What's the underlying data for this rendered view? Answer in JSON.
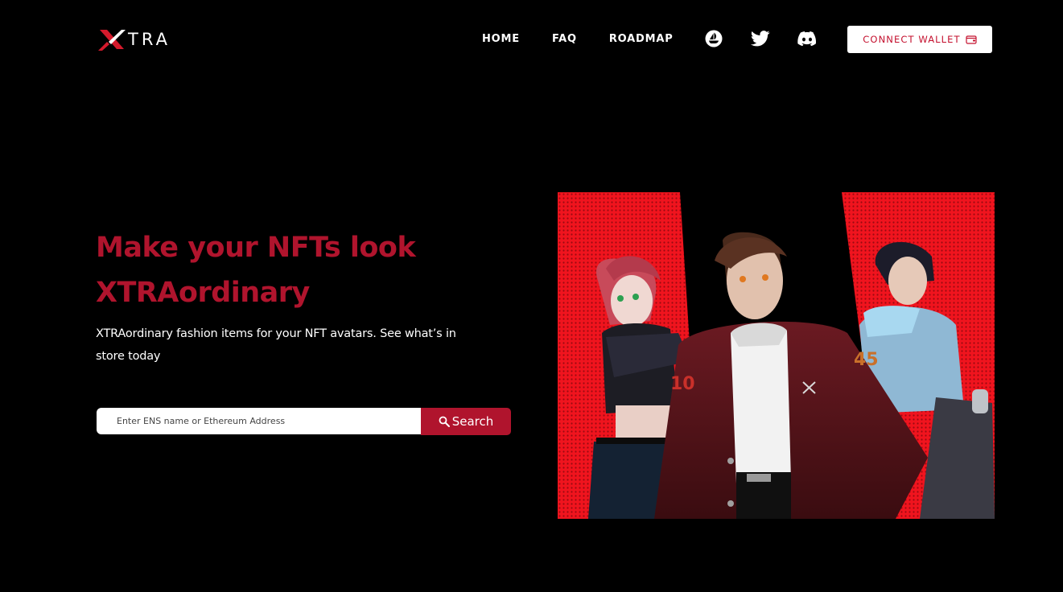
{
  "brand": {
    "logo_text": "TRA",
    "logo_mark": "X",
    "accent": "#b0142d"
  },
  "nav": {
    "home": "HOME",
    "faq": "FAQ",
    "roadmap": "ROADMAP",
    "social": [
      "opensea-icon",
      "twitter-icon",
      "discord-icon"
    ]
  },
  "connect": {
    "label": "CONNECT WALLET"
  },
  "hero": {
    "title_line1": "Make your NFTs look",
    "title_line2": "XTRAordinary",
    "subtitle": "XTRAordinary fashion items for your NFT avatars. See what’s in store today"
  },
  "search": {
    "placeholder": "Enter ENS name or Ethereum Address",
    "button_label": "Search"
  }
}
